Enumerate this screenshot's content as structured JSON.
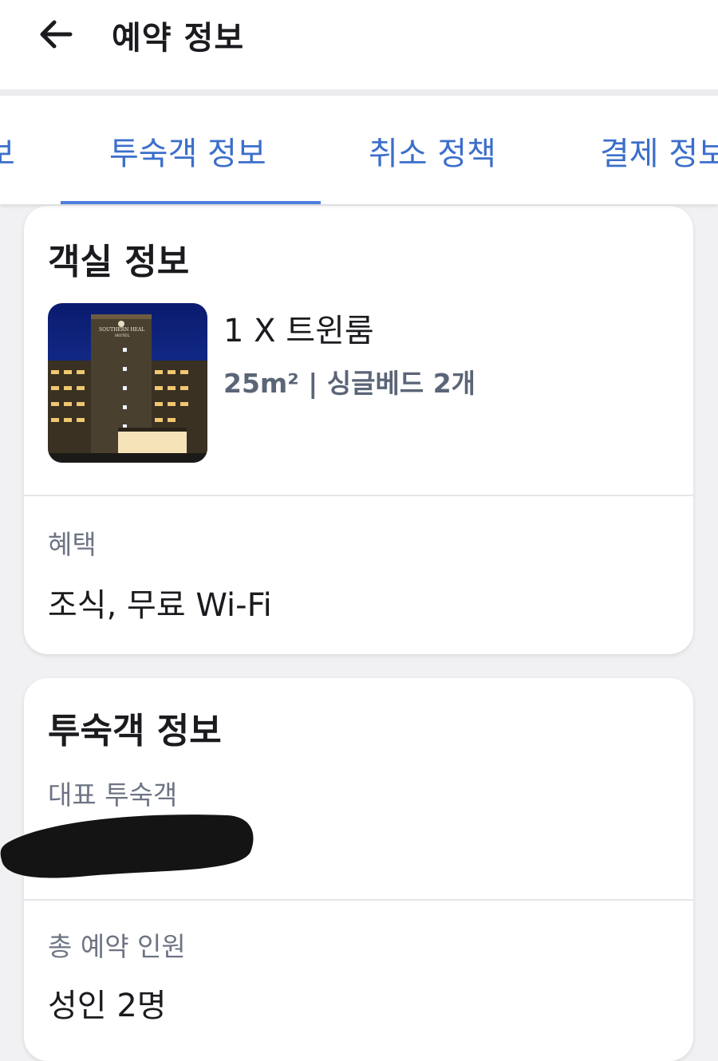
{
  "header": {
    "title": "예약 정보",
    "back_icon": "arrow-left-icon"
  },
  "tabs": [
    {
      "label": "보"
    },
    {
      "label": "투숙객 정보",
      "active": true
    },
    {
      "label": "취소 정책"
    },
    {
      "label": "결제 정보"
    }
  ],
  "room_card": {
    "title": "객실 정보",
    "room_name": "1 X 트윈룸",
    "room_detail": "25m² | 싱글베드 2개",
    "photo_sign": "SOUTHERN HEAL",
    "photo_sign_sub": "HOTEL",
    "benefit_label": "혜택",
    "benefit_value": "조식, 무료 Wi-Fi"
  },
  "guest_card": {
    "title": "투숙객 정보",
    "main_guest_label": "대표 투숙객",
    "main_guest_value": "",
    "total_label": "총 예약 인원",
    "total_value": "성인 2명"
  },
  "colors": {
    "accent": "#4f7fdb",
    "tab_text": "#3c6fcb",
    "background": "#f1f1f3"
  }
}
